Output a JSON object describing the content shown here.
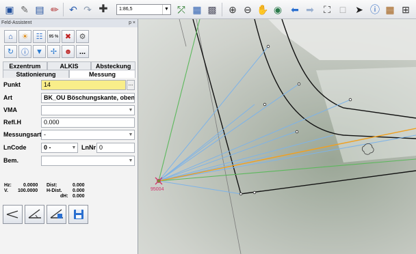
{
  "toolbar": {
    "scale_value": "1:86,5",
    "icons": [
      "save-icon",
      "edit-icon",
      "save-as-icon",
      "pen-icon",
      "undo-icon",
      "redo-icon",
      "crosshair-icon",
      "measure-icon",
      "grid-icon",
      "layers-icon",
      "zoom-in-icon",
      "zoom-out-icon",
      "pan-icon",
      "globe-icon",
      "back-icon",
      "forward-icon",
      "select-region-icon",
      "rectangle-icon",
      "pointer-icon",
      "info-icon",
      "table-icon",
      "zoom-extent-icon"
    ]
  },
  "panel": {
    "title": "Feld-Assistent",
    "pin_close": "p ×",
    "tabs_row1": [
      "Exzentrum",
      "ALKIS",
      "Absteckung"
    ],
    "tabs_row2": [
      "Stationierung",
      "Messung"
    ],
    "active_tab": "Messung",
    "icon_badge": "95 %",
    "more_label": "..."
  },
  "form": {
    "punkt_label": "Punkt",
    "punkt_value": "14",
    "punkt_dots": "...",
    "art_label": "Art",
    "art_value": "BK_OU Böschungskante, oben",
    "vma_label": "VMA",
    "vma_value": "",
    "reflh_label": "Refl.H",
    "reflh_value": "0.000",
    "messungsart_label": "Messungsart",
    "messungsart_value": "-",
    "lncode_label": "LnCode",
    "lncode_value": "0 -",
    "lnnr_label": "LnNr",
    "lnnr_value": "0",
    "bem_label": "Bem.",
    "bem_value": ""
  },
  "readout": {
    "hz_label": "Hz:",
    "hz_value": "0.0000",
    "v_label": "V.",
    "v_value": "100.0000",
    "dist_label": "Dist:",
    "dist_value": "0.000",
    "hdist_label": "H-Dist.",
    "hdist_value": "0.000",
    "dh_label": "dH:",
    "dh_value": "0.000"
  },
  "map": {
    "station_label": "95004"
  },
  "colors": {
    "yellow_field": "#f9ee8a",
    "blue_rays": "#7db3e8",
    "green_rays": "#5cb85c",
    "orange_ray": "#f0a020",
    "station": "#d0306a"
  }
}
